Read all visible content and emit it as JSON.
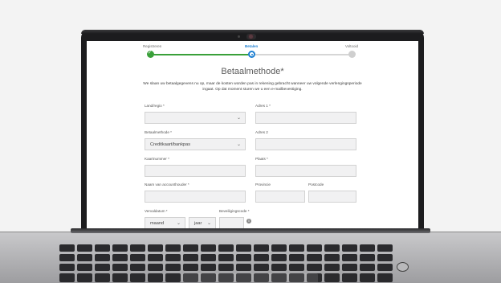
{
  "steps": [
    {
      "label": "Registreren",
      "state": "done"
    },
    {
      "label": "Betalen",
      "state": "active"
    },
    {
      "label": "Voltooid",
      "state": "todo"
    }
  ],
  "colors": {
    "done": "#3aa03a",
    "active": "#1d7fd1",
    "todo": "#cfcfcf"
  },
  "page": {
    "title": "Betaalmethode*",
    "intro": "We slaan uw betaalgegevens nu op, maar de kosten worden pas in rekening gebracht wanneer uw volgende verlengingsperiode ingaat. Op dat moment sturen we u een e-mailbevestiging."
  },
  "form": {
    "country": {
      "label": "Land/regio *",
      "value": ""
    },
    "payment_method": {
      "label": "Betaalmethode *",
      "value": "Creditkaart/bankpas"
    },
    "card_number": {
      "label": "Kaartnummer *",
      "value": ""
    },
    "card_holder": {
      "label": "Naam van accounthouder *",
      "value": ""
    },
    "expiry": {
      "label": "Vervaldatum *",
      "month_value": "maand",
      "year_value": "jaar"
    },
    "security_code": {
      "label": "Beveiligingscode *",
      "value": ""
    },
    "address1": {
      "label": "Adres 1 *",
      "value": ""
    },
    "address2": {
      "label": "Adres 2",
      "value": ""
    },
    "city": {
      "label": "Plaats *",
      "value": ""
    },
    "province": {
      "label": "Provincie",
      "value": ""
    },
    "postcode": {
      "label": "Postcode",
      "value": ""
    }
  },
  "icons": {
    "info": "info-icon",
    "chevron": "chevron-down-icon",
    "check": "checkmark-icon"
  }
}
